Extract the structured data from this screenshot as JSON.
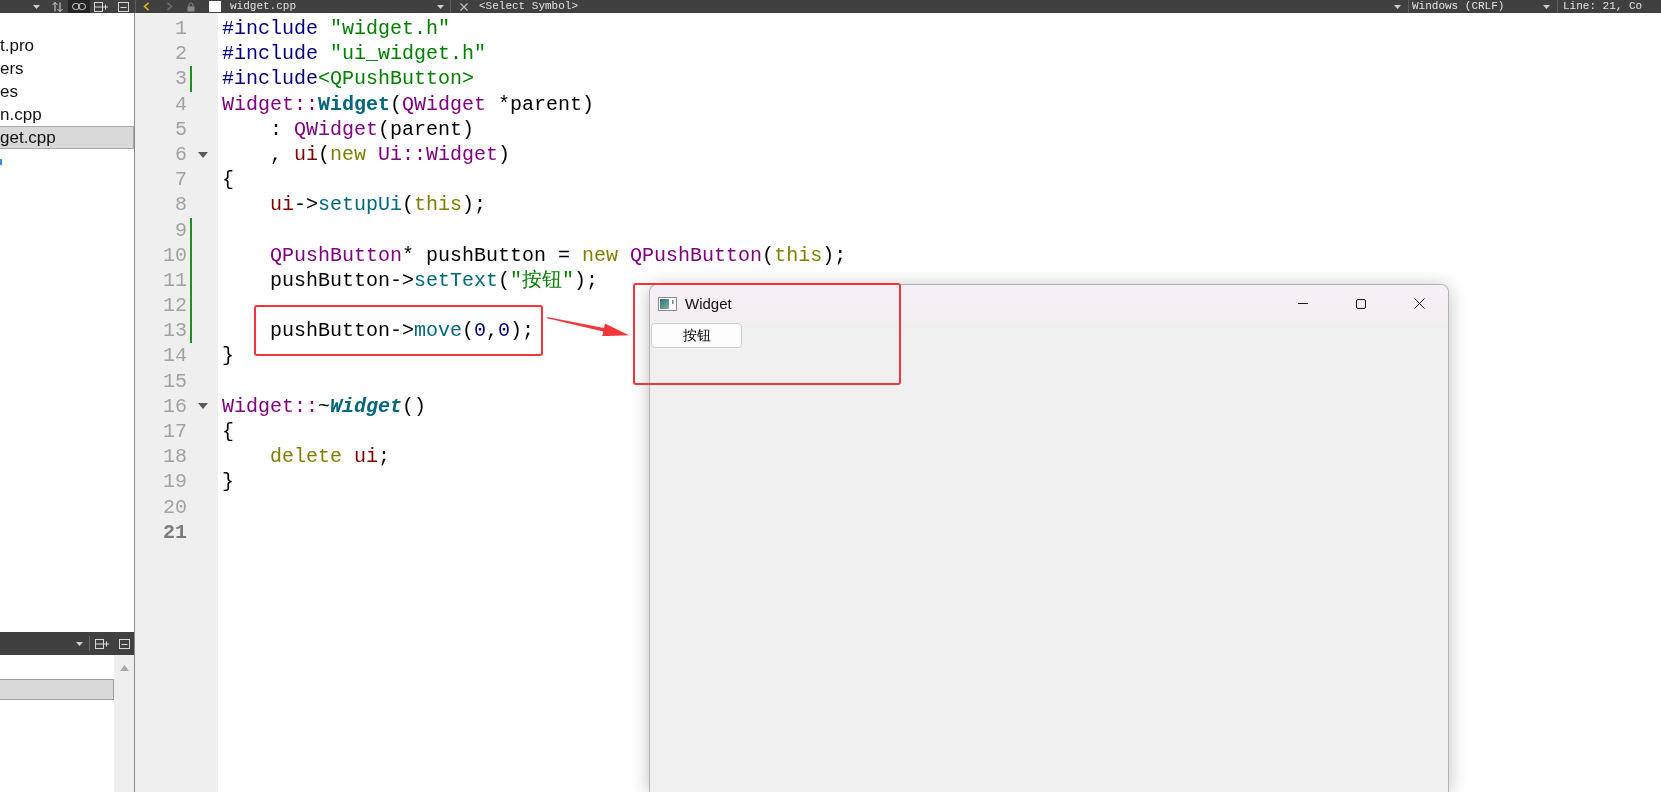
{
  "toolbar": {
    "buttons": [
      {
        "kind": "sort",
        "on": false
      },
      {
        "kind": "link",
        "on": true
      },
      {
        "kind": "split",
        "on": false
      },
      {
        "kind": "panel",
        "on": false
      }
    ],
    "nav": [
      {
        "kind": "back",
        "disabled": false
      },
      {
        "kind": "forward",
        "disabled": true
      }
    ],
    "file": "widget.cpp",
    "symbol": "<Select Symbol>",
    "line_ending": "Windows (CRLF)",
    "cursor": "Line: 21, Co"
  },
  "project_tree": {
    "items": [
      {
        "label": "t.pro",
        "selected": false
      },
      {
        "label": "ers",
        "selected": false
      },
      {
        "label": "es",
        "selected": false
      },
      {
        "label": "n.cpp",
        "selected": false
      },
      {
        "label": "get.cpp",
        "selected": true
      }
    ]
  },
  "bottom_panel": {
    "rows": [
      {
        "selected": true
      }
    ]
  },
  "editor": {
    "lines": [
      {
        "number": "1",
        "tokens": [
          {
            "text": "#include ",
            "kind": "preprocessor"
          },
          {
            "text": "\"widget.h\"",
            "kind": "string"
          }
        ],
        "changed": false,
        "foldable": false,
        "current": false,
        "boxed": false
      },
      {
        "number": "2",
        "tokens": [
          {
            "text": "#include ",
            "kind": "preprocessor"
          },
          {
            "text": "\"ui_widget.h\"",
            "kind": "string"
          }
        ],
        "changed": false,
        "foldable": false,
        "current": false,
        "boxed": false
      },
      {
        "number": "3",
        "tokens": [
          {
            "text": "#include",
            "kind": "preprocessor"
          },
          {
            "text": "<QPushButton>",
            "kind": "string"
          }
        ],
        "changed": true,
        "foldable": false,
        "current": false,
        "boxed": false
      },
      {
        "number": "4",
        "tokens": [
          {
            "text": "Widget::",
            "kind": "type"
          },
          {
            "text": "Widget",
            "kind": "declaration"
          },
          {
            "text": "(",
            "kind": "plain"
          },
          {
            "text": "QWidget",
            "kind": "type"
          },
          {
            "text": " *parent)",
            "kind": "plain"
          }
        ],
        "changed": false,
        "foldable": false,
        "current": false,
        "boxed": false
      },
      {
        "number": "5",
        "tokens": [
          {
            "text": "    : ",
            "kind": "plain"
          },
          {
            "text": "QWidget",
            "kind": "type"
          },
          {
            "text": "(parent)",
            "kind": "plain"
          }
        ],
        "changed": false,
        "foldable": false,
        "current": false,
        "boxed": false
      },
      {
        "number": "6",
        "tokens": [
          {
            "text": "    , ",
            "kind": "plain"
          },
          {
            "text": "ui",
            "kind": "member"
          },
          {
            "text": "(",
            "kind": "plain"
          },
          {
            "text": "new ",
            "kind": "keyword"
          },
          {
            "text": "Ui::Widget",
            "kind": "type"
          },
          {
            "text": ")",
            "kind": "plain"
          }
        ],
        "changed": false,
        "foldable": true,
        "current": false,
        "boxed": false
      },
      {
        "number": "7",
        "tokens": [
          {
            "text": "{",
            "kind": "plain"
          }
        ],
        "changed": false,
        "foldable": false,
        "current": false,
        "boxed": false
      },
      {
        "number": "8",
        "tokens": [
          {
            "text": "    ui",
            "kind": "member"
          },
          {
            "text": "->",
            "kind": "plain"
          },
          {
            "text": "setupUi",
            "kind": "function"
          },
          {
            "text": "(",
            "kind": "plain"
          },
          {
            "text": "this",
            "kind": "keyword"
          },
          {
            "text": ");",
            "kind": "plain"
          }
        ],
        "changed": false,
        "foldable": false,
        "current": false,
        "boxed": false
      },
      {
        "number": "9",
        "changed": true,
        "foldable": false,
        "current": false,
        "boxed": false
      },
      {
        "number": "10",
        "tokens": [
          {
            "text": "    QPushButton",
            "kind": "type"
          },
          {
            "text": "* pushButton = ",
            "kind": "plain"
          },
          {
            "text": "new ",
            "kind": "keyword"
          },
          {
            "text": "QPushButton",
            "kind": "type"
          },
          {
            "text": "(",
            "kind": "plain"
          },
          {
            "text": "this",
            "kind": "keyword"
          },
          {
            "text": ");",
            "kind": "plain"
          }
        ],
        "changed": true,
        "foldable": false,
        "current": false,
        "boxed": false
      },
      {
        "number": "11",
        "tokens": [
          {
            "text": "    pushButton->",
            "kind": "plain"
          },
          {
            "text": "setText",
            "kind": "function"
          },
          {
            "text": "(",
            "kind": "plain"
          },
          {
            "text": "\"按钮\"",
            "kind": "string"
          },
          {
            "text": ");",
            "kind": "plain"
          }
        ],
        "changed": true,
        "foldable": false,
        "current": false,
        "boxed": false
      },
      {
        "number": "12",
        "changed": true,
        "foldable": false,
        "current": false,
        "boxed": false
      },
      {
        "number": "13",
        "tokens": [
          {
            "text": "    pushButton->",
            "kind": "plain"
          },
          {
            "text": "move",
            "kind": "function"
          },
          {
            "text": "(",
            "kind": "plain"
          },
          {
            "text": "0",
            "kind": "number"
          },
          {
            "text": ",",
            "kind": "plain"
          },
          {
            "text": "0",
            "kind": "number"
          },
          {
            "text": ");",
            "kind": "plain"
          }
        ],
        "changed": true,
        "foldable": false,
        "current": false,
        "boxed": true
      },
      {
        "number": "14",
        "tokens": [
          {
            "text": "}",
            "kind": "plain"
          }
        ],
        "changed": false,
        "foldable": false,
        "current": false,
        "boxed": false
      },
      {
        "number": "15",
        "changed": false,
        "foldable": false,
        "current": false,
        "boxed": false
      },
      {
        "number": "16",
        "tokens": [
          {
            "text": "Widget::",
            "kind": "type"
          },
          {
            "text": "~",
            "kind": "plain"
          },
          {
            "text": "Widget",
            "kind": "virtual_declaration"
          },
          {
            "text": "()",
            "kind": "plain"
          }
        ],
        "changed": false,
        "foldable": true,
        "current": false,
        "boxed": false
      },
      {
        "number": "17",
        "tokens": [
          {
            "text": "{",
            "kind": "plain"
          }
        ],
        "changed": false,
        "foldable": false,
        "current": false,
        "boxed": false
      },
      {
        "number": "18",
        "tokens": [
          {
            "text": "    delete ",
            "kind": "keyword"
          },
          {
            "text": "ui",
            "kind": "member"
          },
          {
            "text": ";",
            "kind": "plain"
          }
        ],
        "changed": false,
        "foldable": false,
        "current": false,
        "boxed": false
      },
      {
        "number": "19",
        "tokens": [
          {
            "text": "}",
            "kind": "plain"
          }
        ],
        "changed": false,
        "foldable": false,
        "current": false,
        "boxed": false
      },
      {
        "number": "20",
        "changed": false,
        "foldable": false,
        "current": false,
        "boxed": false
      },
      {
        "number": "21",
        "changed": false,
        "foldable": false,
        "current": true,
        "boxed": false
      }
    ]
  },
  "widget_window": {
    "title": "Widget",
    "button": "按钮",
    "boxed": true
  }
}
